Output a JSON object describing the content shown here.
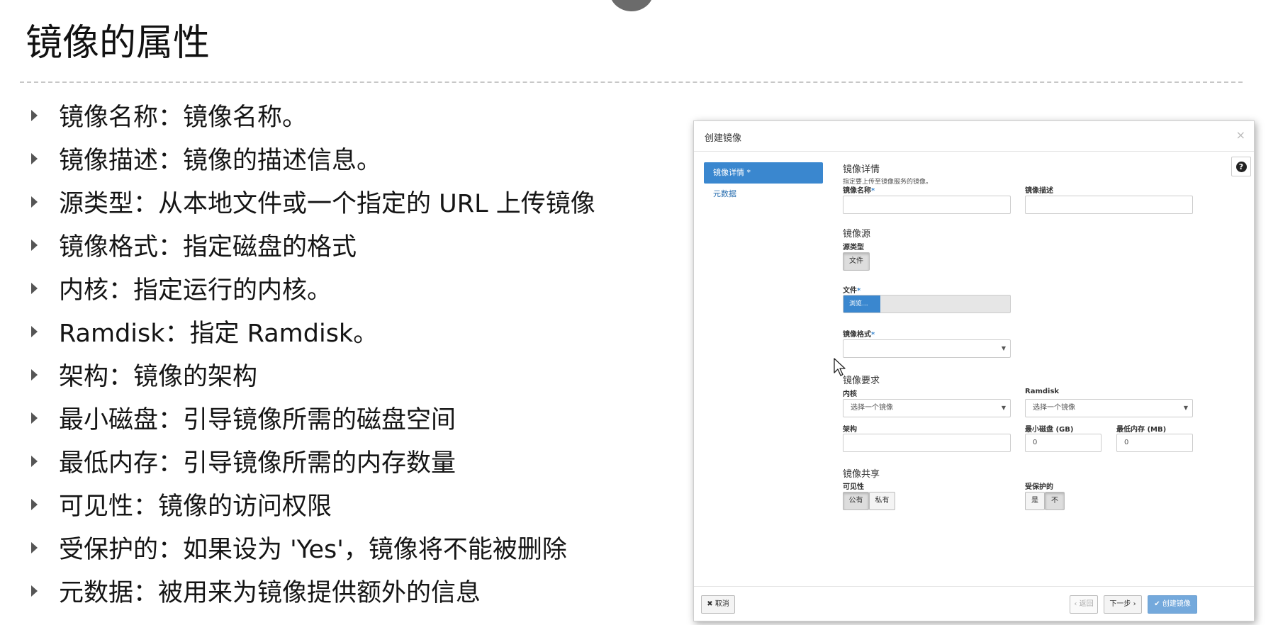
{
  "slide": {
    "title": "镜像的属性",
    "bullets": [
      "镜像名称：镜像名称。",
      "镜像描述：镜像的描述信息。",
      "源类型：从本地文件或一个指定的 URL 上传镜像",
      "镜像格式：指定磁盘的格式",
      "内核：指定运行的内核。",
      "Ramdisk：指定 Ramdisk。",
      "架构：镜像的架构",
      "最小磁盘：引导镜像所需的磁盘空间",
      "最低内存：引导镜像所需的内存数量",
      "可见性：镜像的访问权限",
      "受保护的：如果设为 'Yes'，镜像将不能被删除",
      "元数据：被用来为镜像提供额外的信息"
    ]
  },
  "dialog": {
    "title": "创建镜像",
    "close": "×",
    "help": "?",
    "sidebar": {
      "details": "镜像详情",
      "metadata": "元数据",
      "required_mark": "*"
    },
    "details": {
      "heading": "镜像详情",
      "hint": "指定要上传至镜像服务的镜像。",
      "name_label": "镜像名称",
      "desc_label": "镜像描述",
      "name_value": "",
      "desc_value": ""
    },
    "source": {
      "heading": "镜像源",
      "type_label": "源类型",
      "type_button": "文件",
      "file_label": "文件",
      "browse": "浏览...",
      "format_label": "镜像格式",
      "format_value": ""
    },
    "requirements": {
      "heading": "镜像要求",
      "kernel_label": "内核",
      "kernel_placeholder": "选择一个镜像",
      "ramdisk_label": "Ramdisk",
      "ramdisk_placeholder": "选择一个镜像",
      "arch_label": "架构",
      "arch_value": "",
      "min_disk_label": "最小磁盘 (GB)",
      "min_disk_value": "0",
      "min_ram_label": "最低内存 (MB)",
      "min_ram_value": "0"
    },
    "sharing": {
      "heading": "镜像共享",
      "visibility_label": "可见性",
      "public": "公有",
      "private": "私有",
      "protected_label": "受保护的",
      "yes": "是",
      "no": "不"
    },
    "footer": {
      "cancel": "取消",
      "back": "‹ 返回",
      "next": "下一步 ›",
      "create": "创建镜像"
    },
    "required_mark": "*"
  }
}
